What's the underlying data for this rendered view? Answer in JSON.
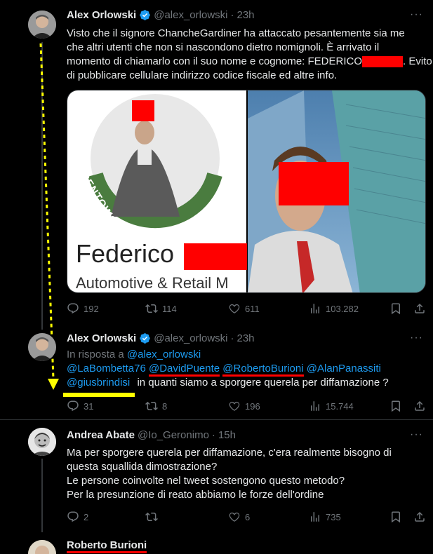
{
  "tweet1": {
    "name": "Alex Orlowski",
    "handle": "@alex_orlowski",
    "time": "23h",
    "text_line1": "Visto che il signore ChancheGardiner ha attaccato pesantemente sia me",
    "text_line2": "che altri utenti che non si nascondono dietro nomignoli. È arrivato il",
    "text_line3a": "momento di chiamarlo con il suo nome e cognome: FEDERICO",
    "text_line3b": ". Evito",
    "text_line4": "di pubblicare cellulare indirizzo codice fiscale ed altre info.",
    "image_left_tag": "#OPENTOWORK",
    "image_left_name": "Federico",
    "image_left_subtitle": "Automotive & Retail M",
    "stats": {
      "replies": "192",
      "retweets": "114",
      "likes": "611",
      "views": "103.282"
    }
  },
  "tweet2": {
    "name": "Alex Orlowski",
    "handle": "@alex_orlowski",
    "time": "23h",
    "reply_prefix": "In risposta a",
    "reply_to": "@alex_orlowski",
    "mention1": "@LaBombetta76",
    "mention2": "@DavidPuente",
    "mention3": "@RobertoBurioni",
    "mention4": "@AlanPanassiti",
    "mention5": "@giusbrindisi",
    "body": "in quanti siamo a sporgere querela per diffamazione ?",
    "stats": {
      "replies": "31",
      "retweets": "8",
      "likes": "196",
      "views": "15.744"
    }
  },
  "tweet3": {
    "name": "Andrea Abate",
    "handle": "@Io_Geronimo",
    "time": "15h",
    "line1": "Ma per sporgere querela per diffamazione, c'era realmente bisogno di",
    "line2": "questa squallida dimostrazione?",
    "line3": "Le persone coinvolte nel tweet sostengono questo metodo?",
    "line4": "Per la presunzione di reato abbiamo le forze dell'ordine",
    "stats": {
      "replies": "2",
      "retweets": "",
      "likes": "6",
      "views": "735"
    }
  },
  "tweet4": {
    "name": "Roberto Burioni"
  },
  "colors": {
    "background": "#000000",
    "link": "#1d9bf0",
    "muted": "#71767b",
    "redaction": "#ff0000",
    "arrow": "#ffff00",
    "opentowork_green": "#4a7c3f"
  },
  "icons": [
    "verified-badge-icon",
    "reply-icon",
    "retweet-icon",
    "like-icon",
    "views-icon",
    "bookmark-icon",
    "share-icon",
    "more-icon"
  ]
}
